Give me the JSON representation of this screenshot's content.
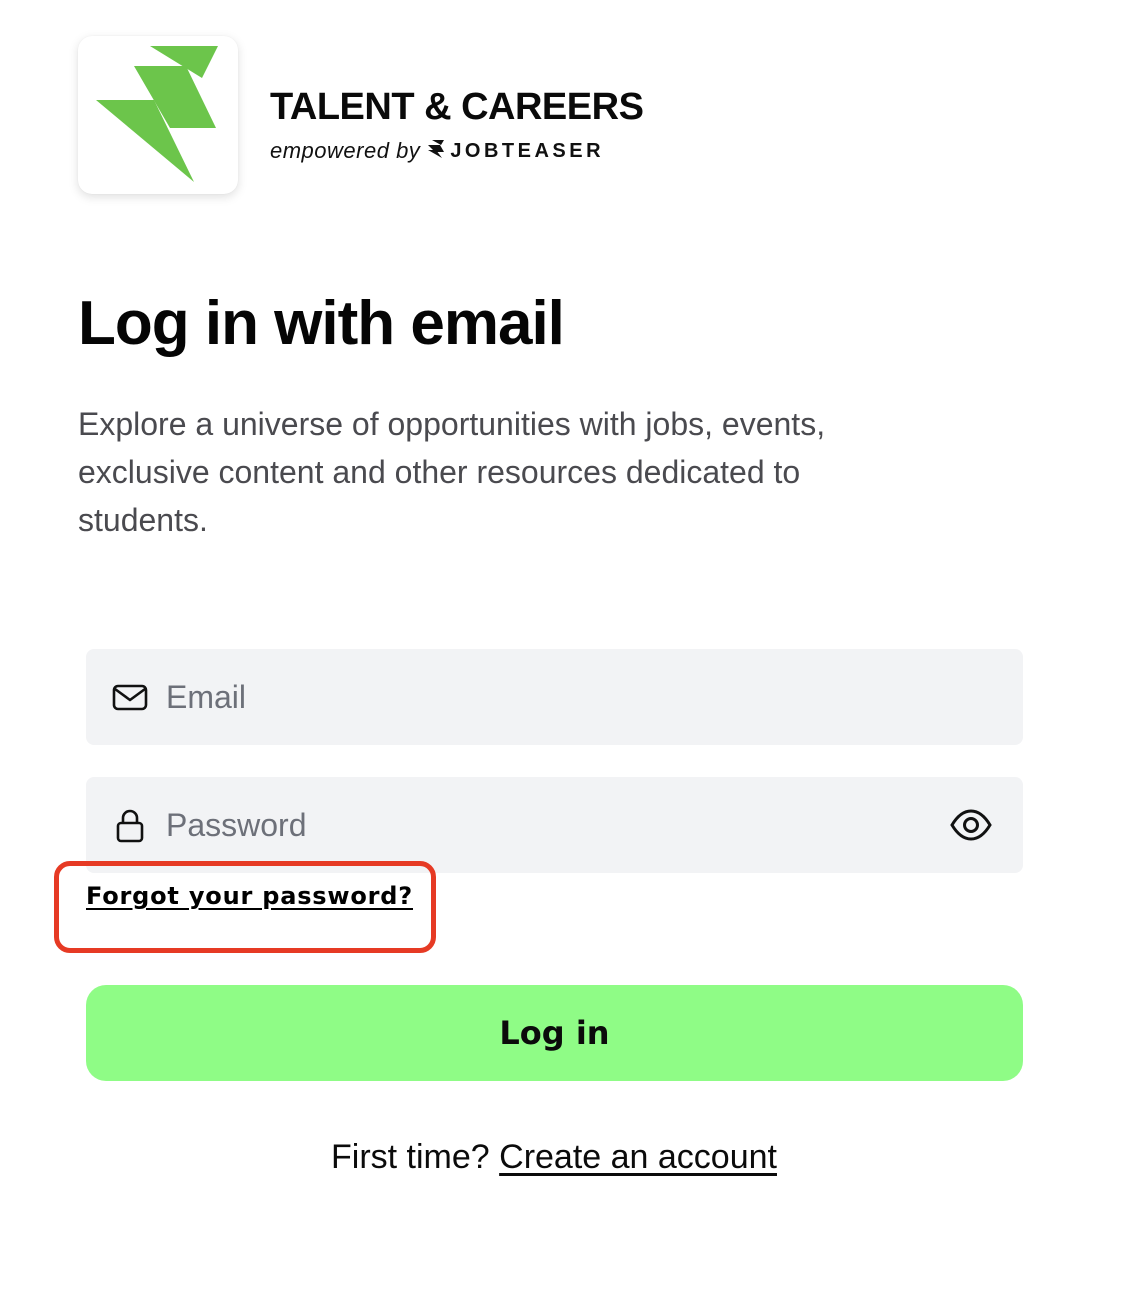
{
  "brand": {
    "title": "TALENT & CAREERS",
    "empowered_by": "empowered by",
    "partner_name": "JOBTEASER",
    "logo_color": "#6cc54b"
  },
  "page": {
    "title": "Log in with email",
    "description": "Explore a universe of opportunities with jobs, events, exclusive content and other resources dedicated to students."
  },
  "form": {
    "email": {
      "placeholder": "Email",
      "value": "",
      "icon": "mail-icon"
    },
    "password": {
      "placeholder": "Password",
      "value": "",
      "icon": "lock-icon",
      "toggle_icon": "eye-icon"
    },
    "forgot_password_label": "Forgot your password?",
    "login_button_label": "Log in"
  },
  "signup": {
    "prompt": "First time?",
    "link_label": "Create an account"
  },
  "colors": {
    "accent_button": "#8ffc86",
    "input_background": "#f2f3f5",
    "highlight": "#e63a24"
  }
}
